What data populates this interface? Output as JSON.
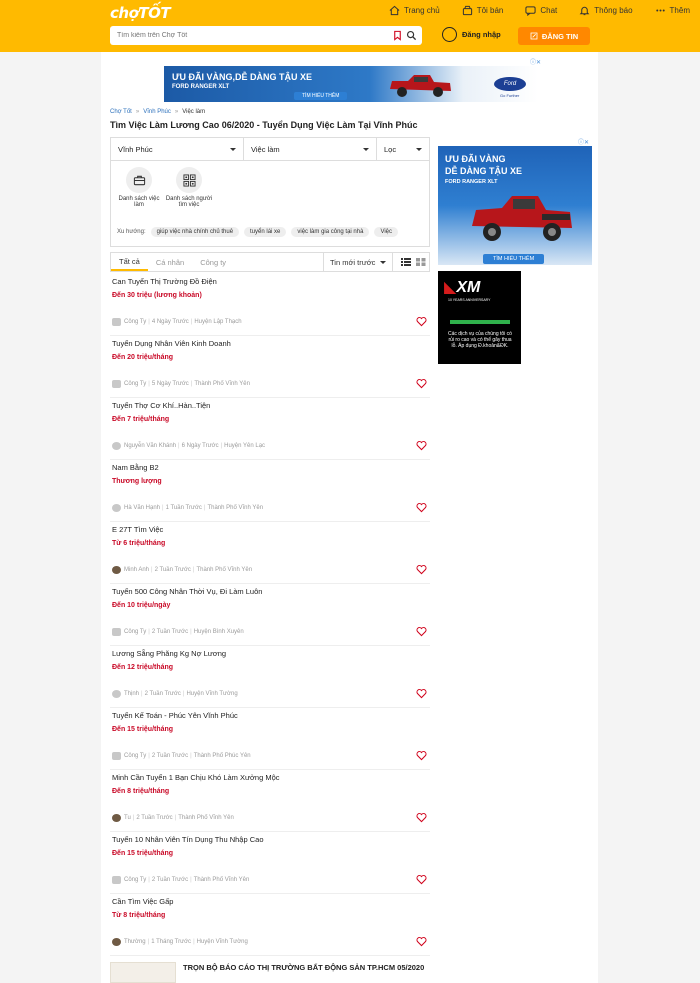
{
  "header": {
    "logo": "chợTỐT",
    "nav": [
      {
        "label": "Trang chủ",
        "icon": "home-icon"
      },
      {
        "label": "Tôi bán",
        "icon": "seller-icon"
      },
      {
        "label": "Chat",
        "icon": "chat-icon"
      },
      {
        "label": "Thông báo",
        "icon": "bell-icon"
      },
      {
        "label": "Thêm",
        "icon": "more-icon"
      }
    ],
    "search_placeholder": "Tìm kiếm trên Chợ Tốt",
    "login_label": "Đăng nhập",
    "post_label": "ĐĂNG TIN"
  },
  "ads": {
    "top": {
      "headline": "ƯU ĐÃI VÀNG,DỄ DÀNG TẬU XE",
      "model": "FORD RANGER XLT",
      "cta": "TÌM HIỂU THÊM",
      "brand": "Ford",
      "tagline": "Go Further"
    },
    "side1": {
      "line1": "ƯU ĐÃI VÀNG",
      "line2": "DỄ DÀNG TẬU XE",
      "model": "FORD RANGER XLT",
      "cta": "TÌM HIỂU THÊM"
    },
    "side2": {
      "brand": "XM",
      "anniversary": "10 YEARS ANNIVERSARY",
      "disclaimer": "Các dịch vụ của chúng tôi có rủi ro cao và có thể gây thua lỗ. Áp dụng Đ.khoản&ĐK."
    }
  },
  "breadcrumb": [
    "Chợ Tốt",
    "Vĩnh Phúc",
    "Việc làm"
  ],
  "page_title": "Tìm Việc Làm Lương Cao 06/2020 - Tuyển Dụng Việc Làm Tại Vĩnh Phúc",
  "filters": {
    "location": "Vĩnh Phúc",
    "category": "Việc làm",
    "filter_label": "Lọc"
  },
  "quick_links": [
    "Danh sách việc làm",
    "Danh sách người tìm việc"
  ],
  "suggest": {
    "label": "Xu hướng:",
    "chips": [
      "giúp việc nhà chính chủ thuê",
      "tuyển lái xe",
      "việc làm gia công tại nhà",
      "Việc"
    ]
  },
  "tabs": {
    "items": [
      "Tất cả",
      "Cá nhân",
      "Công ty"
    ],
    "active": "Tất cả",
    "sort_label": "Tin mới trước"
  },
  "listings": [
    {
      "title": "Can Tuyển Thị Trường Đồ Điện",
      "price": "Đến 30 triệu (lương khoản)",
      "meta": [
        "Công Ty",
        "4 Ngày Trước",
        "Huyện Lập Thạch"
      ],
      "avatar": "company"
    },
    {
      "title": "Tuyển Dụng Nhân Viên Kinh Doanh",
      "price": "Đến 20 triệu/tháng",
      "meta": [
        "Công Ty",
        "5 Ngày Trước",
        "Thành Phố Vĩnh Yên"
      ],
      "avatar": "company"
    },
    {
      "title": "Tuyển Thợ Cơ Khí..Hàn..Tiện",
      "price": "Đến 7 triệu/tháng",
      "meta": [
        "Nguyễn Văn Khánh",
        "6 Ngày Trước",
        "Huyện Yên Lạc"
      ],
      "avatar": "user"
    },
    {
      "title": "Nam Bằng B2",
      "price": "Thương lượng",
      "meta": [
        "Hà Văn Hạnh",
        "1 Tuần Trước",
        "Thành Phố Vĩnh Yên"
      ],
      "avatar": "user"
    },
    {
      "title": "E 27T Tìm Việc",
      "price": "Từ 6 triệu/tháng",
      "meta": [
        "Minh Anh",
        "2 Tuần Trước",
        "Thành Phố Vĩnh Yên"
      ],
      "avatar": "photo"
    },
    {
      "title": "Tuyển 500 Công Nhân Thời Vụ, Đi Làm Luôn",
      "price": "Đến 10 triệu/ngày",
      "meta": [
        "Công Ty",
        "2 Tuần Trước",
        "Huyện Bình Xuyên"
      ],
      "avatar": "company"
    },
    {
      "title": "Lương Sẵng Phăng Kg Nợ Lương",
      "price": "Đến 12 triệu/tháng",
      "meta": [
        "Thịnh",
        "2 Tuần Trước",
        "Huyện Vĩnh Tường"
      ],
      "avatar": "user"
    },
    {
      "title": "Tuyển Kế Toán - Phúc Yên Vĩnh Phúc",
      "price": "Đến 15 triệu/tháng",
      "meta": [
        "Công Ty",
        "2 Tuần Trước",
        "Thành Phố Phúc Yên"
      ],
      "avatar": "company"
    },
    {
      "title": "Minh Cần Tuyển 1 Bạn Chịu Khó Làm Xưởng Mộc",
      "price": "Đến 8 triệu/tháng",
      "meta": [
        "Tu",
        "2 Tuần Trước",
        "Thành Phố Vĩnh Yên"
      ],
      "avatar": "photo"
    },
    {
      "title": "Tuyển 10 Nhân Viên Tín Dụng Thu Nhập Cao",
      "price": "Đến 15 triệu/tháng",
      "meta": [
        "Công Ty",
        "2 Tuần Trước",
        "Thành Phố Vĩnh Yên"
      ],
      "avatar": "company"
    },
    {
      "title": "Cần Tìm Việc Gấp",
      "price": "Từ 8 triệu/tháng",
      "meta": [
        "Thường",
        "1 Tháng Trước",
        "Huyện Vĩnh Tường"
      ],
      "avatar": "photo"
    }
  ],
  "promo": {
    "title": "TRỌN BỘ BÁO CÁO THỊ TRƯỜNG BẤT ĐỘNG SẢN TP.HCM 05/2020"
  },
  "colors": {
    "brand": "#ffba00",
    "accent": "#ff8800",
    "price": "#c90927",
    "link": "#2a6fbb"
  }
}
